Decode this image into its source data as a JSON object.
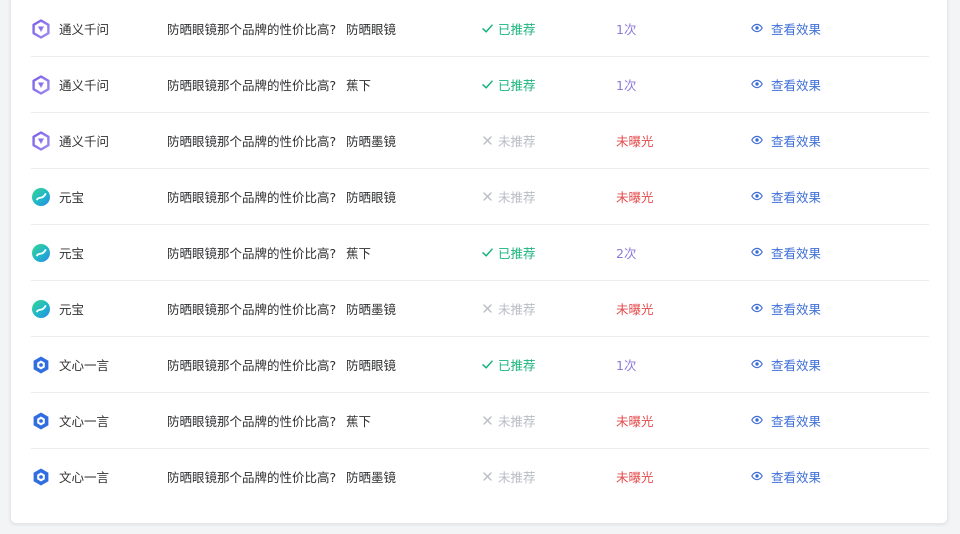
{
  "colors": {
    "recommended": "#19b47d",
    "not_recommended": "#b8bcc4",
    "exposure_count": "#8e79d9",
    "exposure_none": "#e24b4b",
    "link": "#3f6fd7"
  },
  "rows": [
    {
      "platform": "通义千问",
      "platform_icon": "tongyi-icon",
      "question": "防晒眼镜那个品牌的性价比高?",
      "brand": "防晒眼镜",
      "recommended": true,
      "status": "已推荐",
      "exposure": "1次",
      "action": "查看效果"
    },
    {
      "platform": "通义千问",
      "platform_icon": "tongyi-icon",
      "question": "防晒眼镜那个品牌的性价比高?",
      "brand": "蕉下",
      "recommended": true,
      "status": "已推荐",
      "exposure": "1次",
      "action": "查看效果"
    },
    {
      "platform": "通义千问",
      "platform_icon": "tongyi-icon",
      "question": "防晒眼镜那个品牌的性价比高?",
      "brand": "防晒墨镜",
      "recommended": false,
      "status": "未推荐",
      "exposure": "未曝光",
      "action": "查看效果"
    },
    {
      "platform": "元宝",
      "platform_icon": "yuanbao-icon",
      "question": "防晒眼镜那个品牌的性价比高?",
      "brand": "防晒眼镜",
      "recommended": false,
      "status": "未推荐",
      "exposure": "未曝光",
      "action": "查看效果"
    },
    {
      "platform": "元宝",
      "platform_icon": "yuanbao-icon",
      "question": "防晒眼镜那个品牌的性价比高?",
      "brand": "蕉下",
      "recommended": true,
      "status": "已推荐",
      "exposure": "2次",
      "action": "查看效果"
    },
    {
      "platform": "元宝",
      "platform_icon": "yuanbao-icon",
      "question": "防晒眼镜那个品牌的性价比高?",
      "brand": "防晒墨镜",
      "recommended": false,
      "status": "未推荐",
      "exposure": "未曝光",
      "action": "查看效果"
    },
    {
      "platform": "文心一言",
      "platform_icon": "wenxin-icon",
      "question": "防晒眼镜那个品牌的性价比高?",
      "brand": "防晒眼镜",
      "recommended": true,
      "status": "已推荐",
      "exposure": "1次",
      "action": "查看效果"
    },
    {
      "platform": "文心一言",
      "platform_icon": "wenxin-icon",
      "question": "防晒眼镜那个品牌的性价比高?",
      "brand": "蕉下",
      "recommended": false,
      "status": "未推荐",
      "exposure": "未曝光",
      "action": "查看效果"
    },
    {
      "platform": "文心一言",
      "platform_icon": "wenxin-icon",
      "question": "防晒眼镜那个品牌的性价比高?",
      "brand": "防晒墨镜",
      "recommended": false,
      "status": "未推荐",
      "exposure": "未曝光",
      "action": "查看效果"
    }
  ]
}
